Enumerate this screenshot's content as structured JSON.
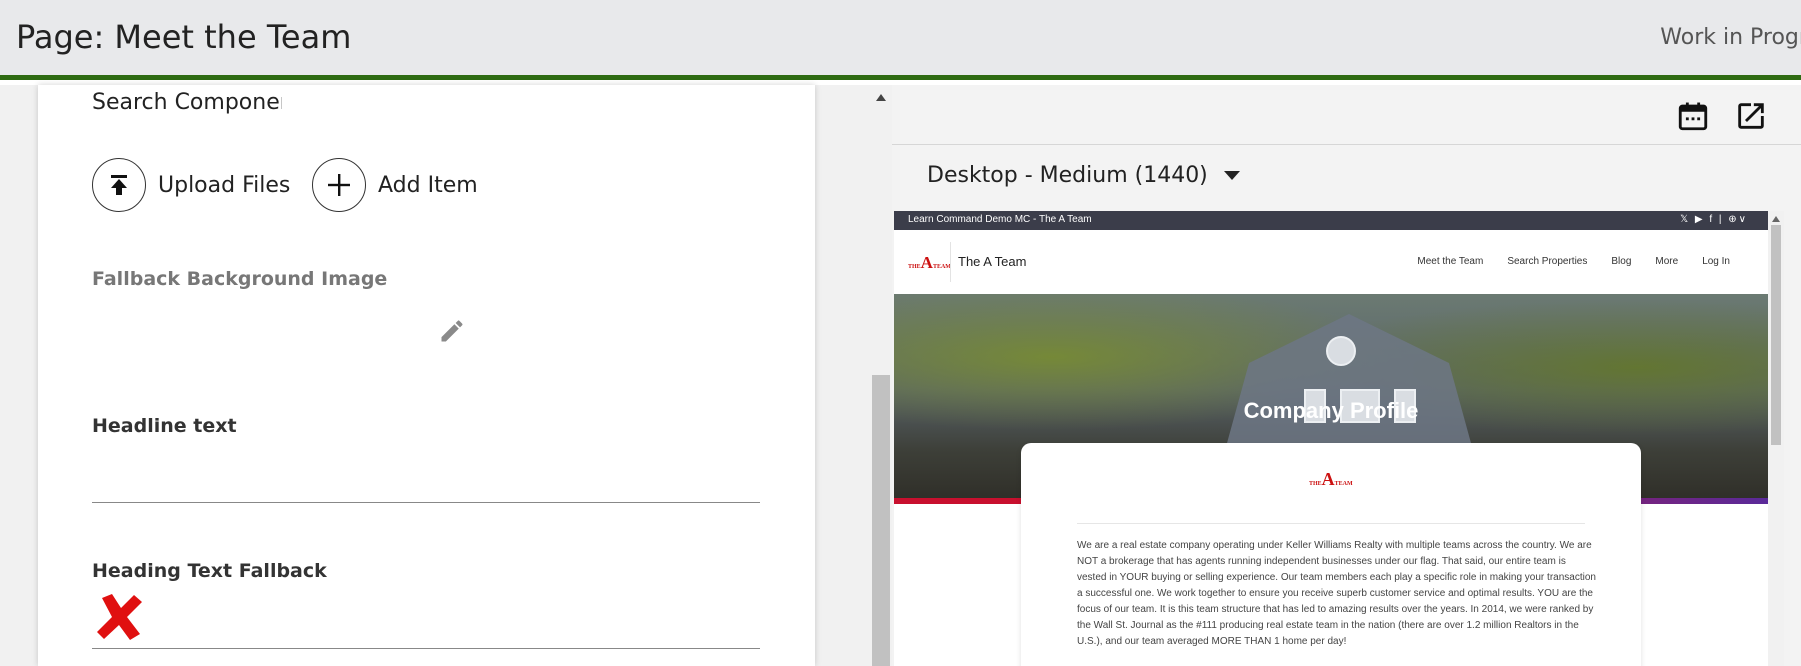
{
  "header": {
    "title": "Page: Meet the Team",
    "status": "Work in Progre"
  },
  "editor": {
    "search_placeholder": "Search Component",
    "actions": {
      "upload_label": "Upload Files",
      "add_label": "Add Item"
    },
    "fields": {
      "fallback_bg_label": "Fallback Background Image",
      "headline_label": "Headline text",
      "heading_fallback_label": "Heading Text Fallback"
    }
  },
  "preview_controls": {
    "device_label": "Desktop - Medium (1440)",
    "icons": [
      "calendar-icon",
      "open-external-icon"
    ]
  },
  "site_preview": {
    "topbar_text": "Learn Command Demo MC - The A Team",
    "social": "𝕏 ▶ f | ⊕∨",
    "logo": {
      "small_top": "THE",
      "letter": "A",
      "small_side": "TEAM"
    },
    "brand": "The A Team",
    "menu": [
      "Meet the Team",
      "Search Properties",
      "Blog",
      "More",
      "Log In"
    ],
    "hero_title": "Company Profile",
    "body": "We are a real estate company operating under Keller Williams Realty with multiple teams across the country. We are NOT a brokerage that has agents running independent businesses under our flag. That said, our entire team is vested in YOUR buying or selling experience. Our team members each play a specific role in making your transaction a successful one. We work together to ensure you receive superb customer service and optimal results. YOU are the focus of our team. It is this team structure that has led to amazing results over the years. In 2014, we were ranked by the Wall St. Journal as the #111 producing real estate team in the nation (there are over 1.2 million Realtors in the U.S.), and our team averaged MORE THAN 1 home per day!"
  },
  "colors": {
    "header_accent": "#2e6b12",
    "brand_red": "#cc1111",
    "error_red": "#e01010"
  }
}
